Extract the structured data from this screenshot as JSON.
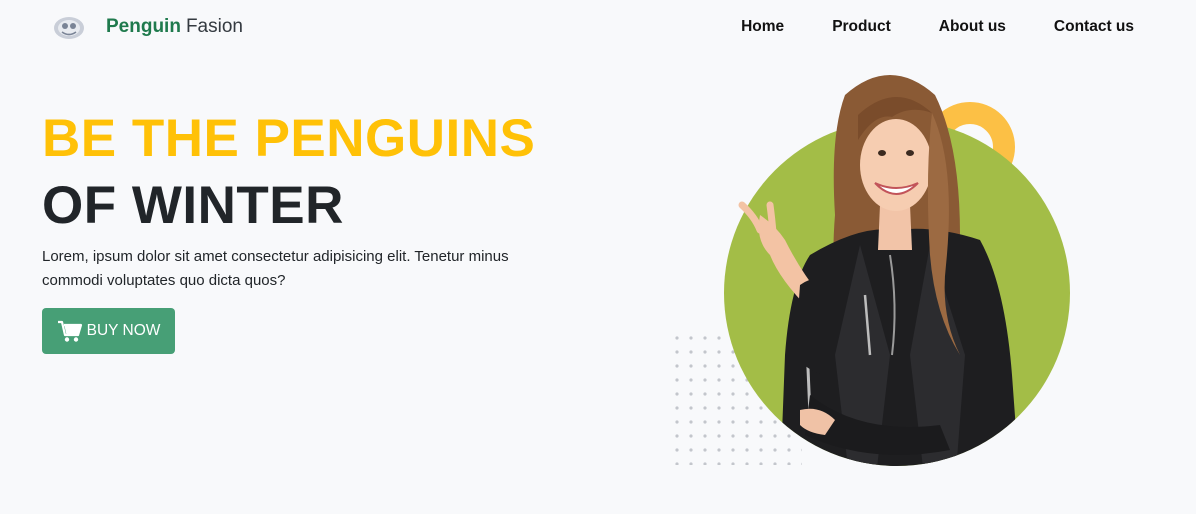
{
  "brand": {
    "name_strong": "Penguin",
    "name_light": "Fasion",
    "logo_icon": "penguin-logo-icon"
  },
  "nav": {
    "items": [
      {
        "label": "Home"
      },
      {
        "label": "Product"
      },
      {
        "label": "About us"
      },
      {
        "label": "Contact us"
      }
    ]
  },
  "hero": {
    "title_line1": "BE THE PENGUINS",
    "title_line2": "OF WINTER",
    "description": "Lorem, ipsum dolor sit amet consectetur adipisicing elit. Tenetur minus commodi voluptates quo dicta quos?",
    "button_label": "BUY NOW",
    "button_icon": "cart-icon",
    "image": "smiling-woman-leather-jacket"
  },
  "colors": {
    "accent_yellow": "#ffc107",
    "brand_green": "#1f7a4d",
    "button_green": "#479f76",
    "circle_green": "#a3bd47",
    "ring_orange": "#fcc045"
  }
}
